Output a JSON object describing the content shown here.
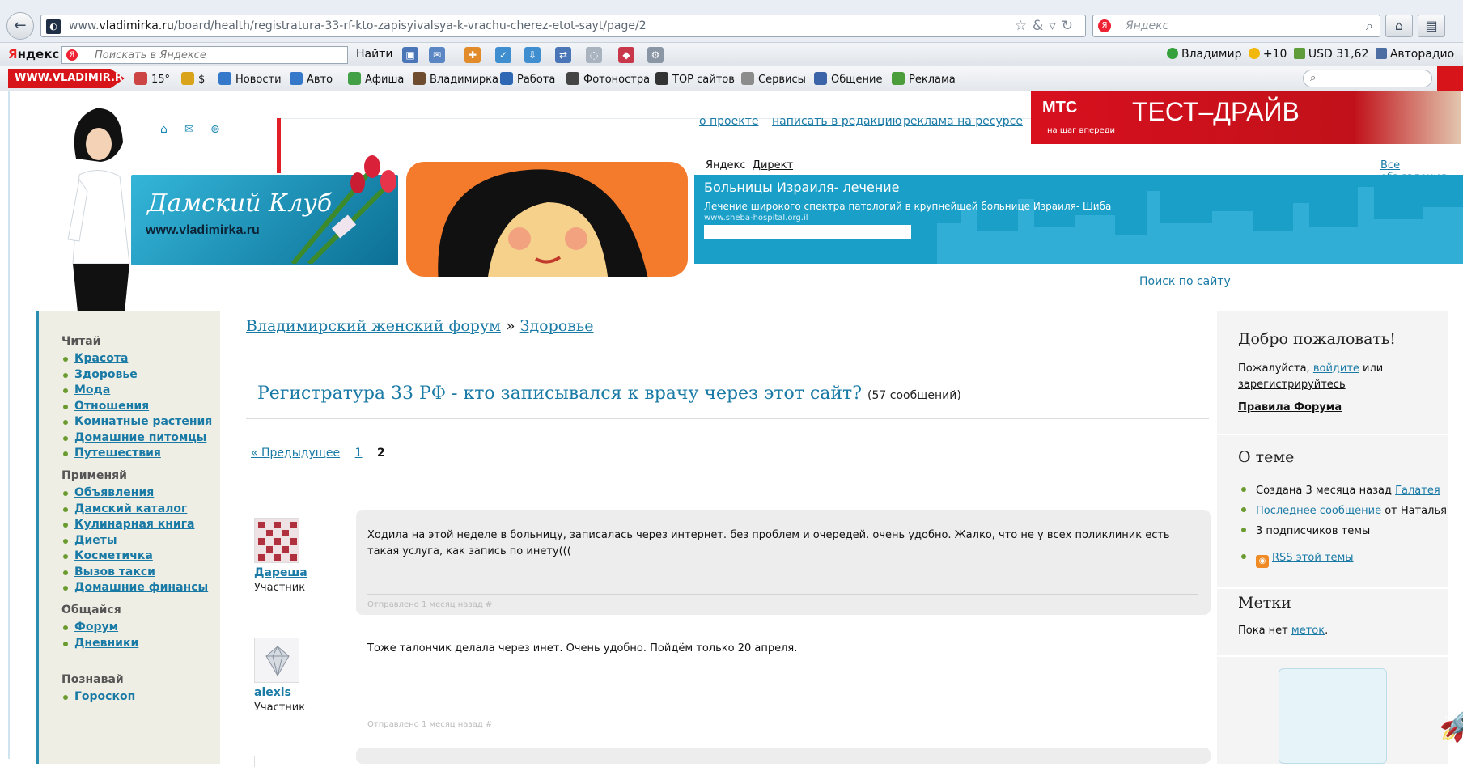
{
  "browser": {
    "url_prefix": "www.",
    "url_domain": "vladimirka.ru",
    "url_path": "/board/health/registratura-33-rf-kto-zapisyivalsya-k-vrachu-cherez-etot-sayt/page/2",
    "search_placeholder": "Яндекс"
  },
  "yandex_toolbar": {
    "logo_first": "Я",
    "logo_rest": "ндекс",
    "search_placeholder": "Поискать в Яндексе",
    "find_label": "Найти",
    "user": "Владимир",
    "points": "+10",
    "currency": "USD 31,62",
    "radio": "Авторадио"
  },
  "linkbar": {
    "brand": "WWW.VLADIMIR.RU",
    "weather": "15°",
    "money": "$",
    "items": [
      "Новости",
      "Авто",
      "Афиша",
      "Владимирка",
      "Работа",
      "Фотоностра",
      "TOP сайтов",
      "Сервисы",
      "Общение",
      "Реклама"
    ]
  },
  "header": {
    "links": [
      "о проекте",
      "написать в редакцию",
      "реклама на ресурсе"
    ],
    "club_title": "Дамский Клуб",
    "club_url": "www.vladimirka.ru",
    "mts_brand": "МТС",
    "mts_slogan": "на шаг впереди",
    "mts_promo": "ТЕСТ–ДРАЙВ",
    "ad_label_1": "Яндекс",
    "ad_label_2": "Директ",
    "all_ads": "Все объявления",
    "ad_title": "Больницы Израиля- лечение",
    "ad_desc": "Лечение широкого спектра патологий в крупнейшей больнице Израиля- Шиба",
    "ad_url": "www.sheba-hospital.org.il",
    "site_search": "Поиск по сайту"
  },
  "left_sidebar": {
    "sections": [
      {
        "title": "Читай",
        "items": [
          "Красота",
          "Здоровье",
          "Мода",
          "Отношения",
          "Комнатные растения",
          "Домашние питомцы",
          "Путешествия"
        ]
      },
      {
        "title": "Применяй",
        "items": [
          "Объявления",
          "Дамский каталог",
          "Кулинарная книга",
          "Диеты",
          "Косметичка",
          "Вызов такси",
          "Домашние финансы"
        ]
      },
      {
        "title": "Общайся",
        "items": [
          "Форум",
          "Дневники"
        ]
      },
      {
        "title": "Познавай",
        "items": [
          "Гороскоп"
        ]
      }
    ]
  },
  "main": {
    "breadcrumb_forum": "Владимирский женский форум",
    "breadcrumb_sep": "»",
    "breadcrumb_section": "Здоровье",
    "topic_title": "Регистратура 33 РФ - кто записывался к врачу через этот сайт?",
    "topic_count": "(57 сообщений)",
    "pager_prev": "« Предыдущее",
    "pager_page1": "1",
    "pager_current": "2",
    "posts": [
      {
        "author": "Дареша",
        "role": "Участник",
        "text": "Ходила на этой неделе в больницу, записалась через интернет. без проблем и очередей. очень удобно. Жалко, что не у всех поликлиник есть такая услуга, как запись по инету(((",
        "meta": "Отправлено 1 месяц назад #"
      },
      {
        "author": "alexis",
        "role": "Участник",
        "text": "Тоже талончик делала через инет. Очень удобно. Пойдём только 20 апреля.",
        "meta": "Отправлено 1 месяц назад #"
      }
    ]
  },
  "right_sidebar": {
    "welcome_title": "Добро пожаловать!",
    "welcome_text_1": "Пожалуйста,",
    "login_link": "войдите",
    "welcome_text_2": "или",
    "register_link": "зарегистрируйтесь",
    "rules_link": "Правила Форума",
    "topic_title": "О теме",
    "created_text": "Создана 3 месяца назад",
    "created_by": "Галатея",
    "last_post_link": "Последнее сообщение",
    "last_post_by": "от Наталья",
    "subscribers": "3 подписчиков темы",
    "rss_link": "RSS этой темы",
    "tags_title": "Метки",
    "tags_text": "Пока нет",
    "tags_link": "меток",
    "tags_end": "."
  },
  "colors": {
    "link": "#1a7aa6",
    "brand_red": "#d7141a",
    "ad_blue": "#1a9fc8",
    "bullet_green": "#6a9b2f"
  }
}
